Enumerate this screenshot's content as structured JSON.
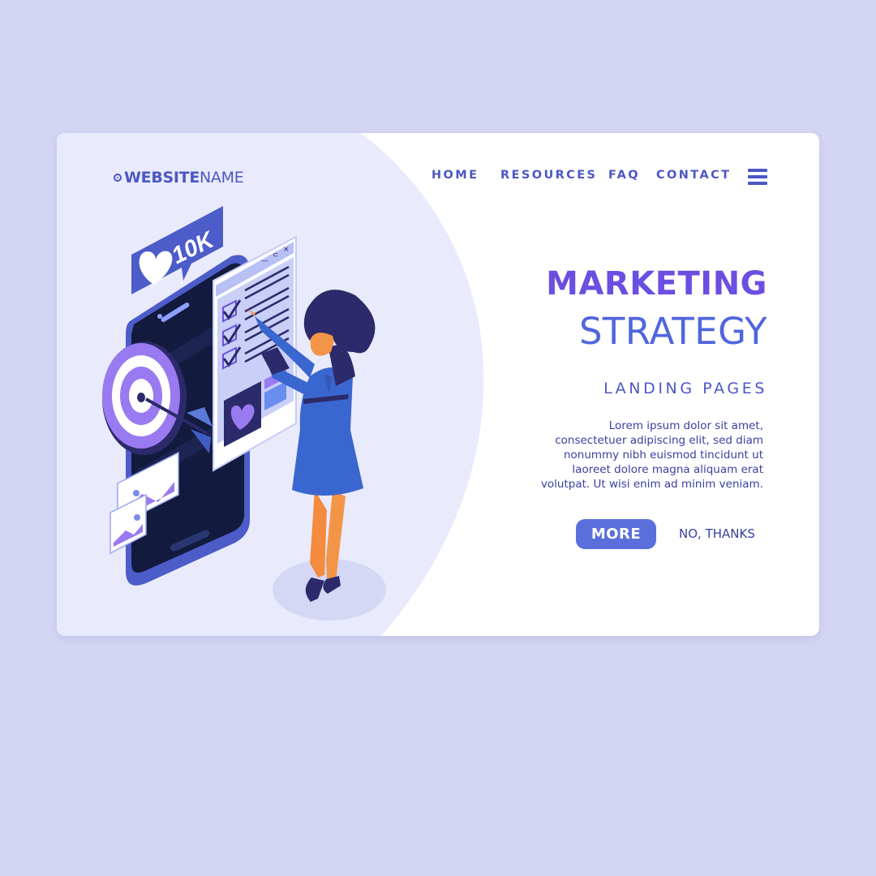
{
  "logo": {
    "bold": "WEBSITE",
    "light": "NAME"
  },
  "nav": {
    "items": [
      "HOME",
      "RESOURCES",
      "FAQ",
      "CONTACT"
    ]
  },
  "hero": {
    "title_line1": "MARKETING",
    "title_line2": "STRATEGY",
    "subtitle": "LANDING PAGES",
    "body_lines": [
      "Lorem ipsum dolor sit amet,",
      "consectetuer adipiscing elit, sed diam",
      "nonummy nibh euismod tincidunt ut",
      "laoreet dolore magna aliquam erat",
      "volutpat. Ut wisi enim ad minim veniam."
    ],
    "more_label": "MORE",
    "no_label": "NO, THANKS"
  },
  "illustration": {
    "like_badge": "10K"
  },
  "icons": [
    "target-dot-icon",
    "menu-icon",
    "heart-icon",
    "checkmark-icon",
    "image-icon",
    "minimize-icon",
    "link-icon",
    "close-icon"
  ],
  "colors": {
    "page_bg": "#d3d5f3",
    "card_bg": "#ffffff",
    "left_panel": "#e9ebfc",
    "accent": "#4c57c5",
    "title_purple": "#6b4fe0",
    "title_blue": "#5066dd",
    "button": "#5b6fdc"
  }
}
